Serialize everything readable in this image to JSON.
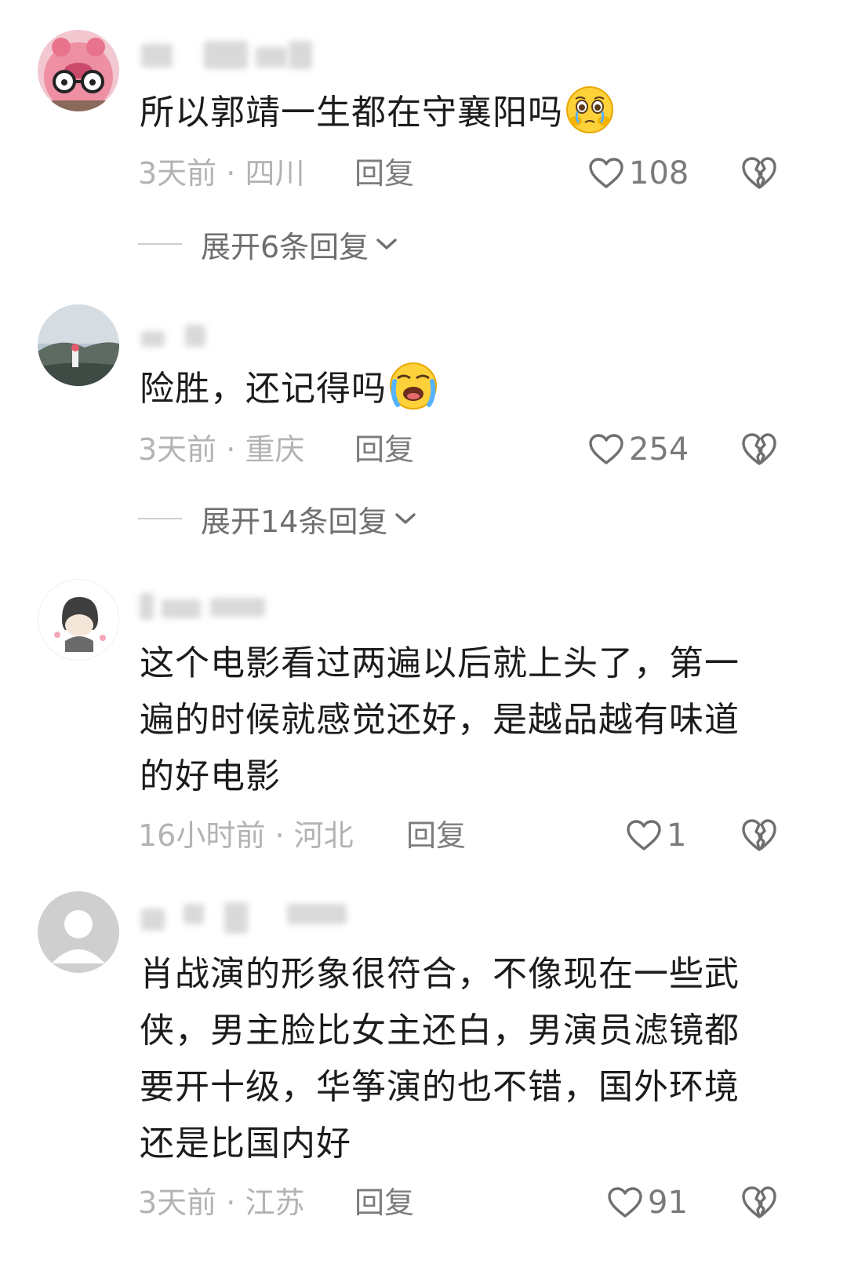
{
  "comments": [
    {
      "text": "所以郭靖一生都在守襄阳吗",
      "emoji": "pleading-crying-face-emoji",
      "time": "3天前",
      "separator": "·",
      "location": "四川",
      "reply_label": "回复",
      "like_count": "108",
      "expand_label": "展开6条回复"
    },
    {
      "text": "险胜，还记得吗",
      "emoji": "loudly-crying-face-emoji",
      "time": "3天前",
      "separator": "·",
      "location": "重庆",
      "reply_label": "回复",
      "like_count": "254",
      "expand_label": "展开14条回复"
    },
    {
      "text": "这个电影看过两遍以后就上头了，第一遍的时候就感觉还好，是越品越有味道的好电影",
      "time": "16小时前",
      "separator": "·",
      "location": "河北",
      "reply_label": "回复",
      "like_count": "1"
    },
    {
      "text": "肖战演的形象很符合，不像现在一些武侠，男主脸比女主还白，男演员滤镜都要开十级，华筝演的也不错，国外环境还是比国内好",
      "time": "3天前",
      "separator": "·",
      "location": "江苏",
      "reply_label": "回复",
      "like_count": "91"
    }
  ],
  "colors": {
    "text": "#1c1c1c",
    "meta": "#b3b3b3",
    "icon": "#7a7a7a",
    "emoji_yellow": "#fdd13a"
  }
}
